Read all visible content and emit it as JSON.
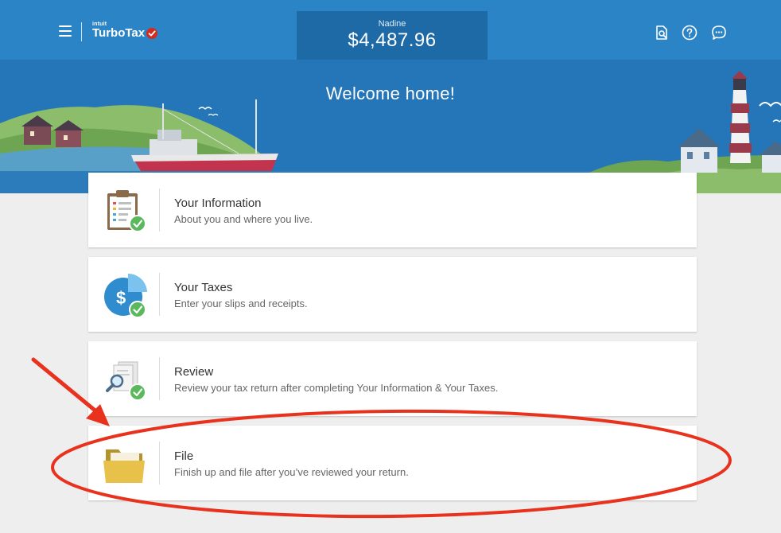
{
  "brand": {
    "intuit": "intuit",
    "name": "TurboTax"
  },
  "refund": {
    "name": "Nadine",
    "amount": "$4,487.96"
  },
  "header": {
    "icons": [
      "search-document-icon",
      "help-icon",
      "chat-icon"
    ]
  },
  "banner": {
    "title": "Welcome home!"
  },
  "cards": [
    {
      "title": "Your Information",
      "subtitle": "About you and where you live.",
      "icon": "clipboard-icon",
      "completed": true
    },
    {
      "title": "Your Taxes",
      "subtitle": "Enter your slips and receipts.",
      "icon": "dollar-pie-icon",
      "completed": true
    },
    {
      "title": "Review",
      "subtitle": "Review your tax return after completing Your Information & Your Taxes.",
      "icon": "magnifier-documents-icon",
      "completed": true
    },
    {
      "title": "File",
      "subtitle": "Finish up and file after you’ve reviewed your return.",
      "icon": "folder-icon",
      "completed": false
    }
  ],
  "colors": {
    "topbar": "#2b84c6",
    "refund_box": "#1d6aa6",
    "check_green": "#5cb85c",
    "annotation_red": "#e8321e"
  }
}
